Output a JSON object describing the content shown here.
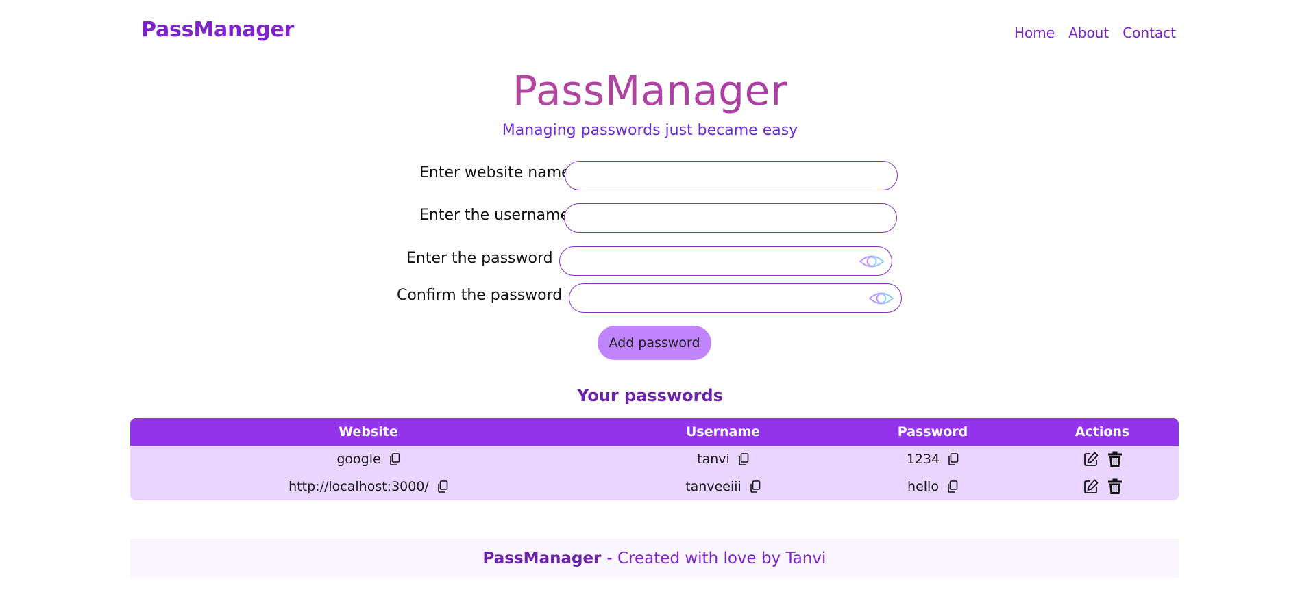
{
  "nav": {
    "brand": "PassManager",
    "links": [
      "Home",
      "About",
      "Contact"
    ]
  },
  "hero": {
    "title": "PassManager",
    "subtitle": "Managing passwords just became easy"
  },
  "form": {
    "website_label": "Enter website name",
    "username_label": "Enter the username",
    "password_label": "Enter the password",
    "confirm_label": "Confirm the password",
    "website_value": "",
    "username_value": "",
    "password_value": "",
    "confirm_value": "",
    "add_button_label": "Add password"
  },
  "table": {
    "title": "Your passwords",
    "headers": [
      "Website",
      "Username",
      "Password",
      "Actions"
    ],
    "rows": [
      {
        "website": "google",
        "username": "tanvi",
        "password": "1234"
      },
      {
        "website": "http://localhost:3000/",
        "username": "tanveeiii",
        "password": "hello"
      }
    ]
  },
  "footer": {
    "brand": "PassManager",
    "text": "- Created with love by Tanvi"
  },
  "colors": {
    "accent": "#9333ea",
    "brand": "#7e22ce",
    "row_bg": "#e9d5ff",
    "button_bg": "#c084fc"
  }
}
